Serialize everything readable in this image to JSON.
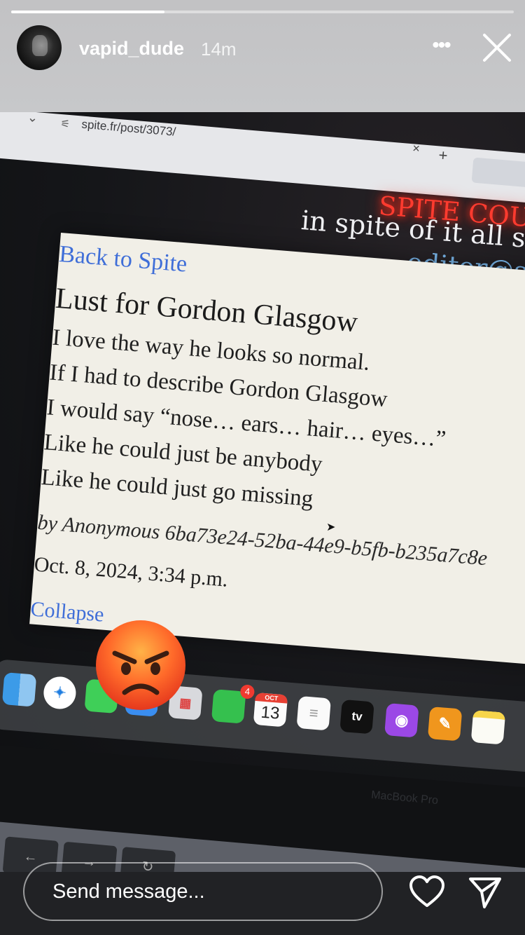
{
  "story": {
    "username": "vapid_dude",
    "time_ago": "14m",
    "progress_fraction": 0.305,
    "more_icon": "more-horizontal-icon",
    "close_icon": "close-icon"
  },
  "photo": {
    "browser": {
      "url": "spite.fr/post/3073/",
      "tab_close": "×",
      "new_tab": "+"
    },
    "site": {
      "neon_title": "SPITE COUN",
      "tagline": "in spite of it all si",
      "editor_email": "editor@sp"
    },
    "post": {
      "back_link": "Back to Spite",
      "title": "Lust for Gordon Glasgow",
      "lines": [
        "I love the way he looks so normal.",
        "If I had to describe Gordon Glasgow",
        "I would say “nose… ears… hair… eyes…”",
        "Like he could just be anybody",
        "Like he could just go missing"
      ],
      "byline": "by Anonymous 6ba73e24-52ba-44e9-b5fb-b235a7c8e",
      "date": "Oct. 8, 2024, 3:34 p.m.",
      "collapse_link": "Collapse"
    },
    "dock": {
      "facetime_badge": "4",
      "calendar_month": "OCT",
      "calendar_day": "13",
      "tv_label": "tv"
    },
    "laptop_label": "MacBook Pro",
    "sticker": "angry-face-emoji"
  },
  "footer": {
    "message_placeholder": "Send message...",
    "heart_icon": "heart-icon",
    "send_icon": "send-icon"
  },
  "colors": {
    "header_bg": "#c4c5c7",
    "footer_bg": "#212225",
    "link_blue": "#3f6ed8",
    "neon_red": "#ff3b2f",
    "email_blue": "#79b6ea",
    "card_bg": "#f1efe7"
  }
}
